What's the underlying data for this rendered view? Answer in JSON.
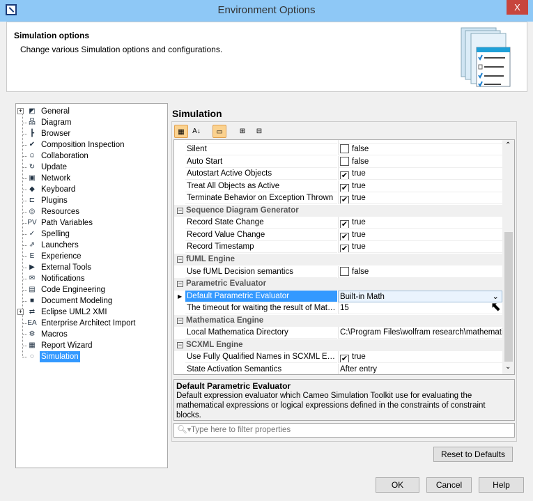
{
  "window": {
    "title": "Environment Options",
    "close": "X"
  },
  "header": {
    "title": "Simulation options",
    "subtitle": "Change various Simulation options and configurations."
  },
  "tree": [
    {
      "label": "General",
      "icon": "general-icon",
      "glyph": "◩",
      "expand": true
    },
    {
      "label": "Diagram",
      "icon": "diagram-icon",
      "glyph": "品"
    },
    {
      "label": "Browser",
      "icon": "browser-icon",
      "glyph": "┣"
    },
    {
      "label": "Composition Inspection",
      "icon": "composition-icon",
      "glyph": "✔"
    },
    {
      "label": "Collaboration",
      "icon": "collaboration-icon",
      "glyph": "☺"
    },
    {
      "label": "Update",
      "icon": "update-icon",
      "glyph": "↻"
    },
    {
      "label": "Network",
      "icon": "network-icon",
      "glyph": "▣"
    },
    {
      "label": "Keyboard",
      "icon": "keyboard-icon",
      "glyph": "◆"
    },
    {
      "label": "Plugins",
      "icon": "plugins-icon",
      "glyph": "⊏"
    },
    {
      "label": "Resources",
      "icon": "resources-icon",
      "glyph": "◎"
    },
    {
      "label": "Path Variables",
      "icon": "path-variables-icon",
      "glyph": "PV"
    },
    {
      "label": "Spelling",
      "icon": "spelling-icon",
      "glyph": "✓"
    },
    {
      "label": "Launchers",
      "icon": "launchers-icon",
      "glyph": "⇗"
    },
    {
      "label": "Experience",
      "icon": "experience-icon",
      "glyph": "E"
    },
    {
      "label": "External Tools",
      "icon": "external-tools-icon",
      "glyph": "▶"
    },
    {
      "label": "Notifications",
      "icon": "notifications-icon",
      "glyph": "✉"
    },
    {
      "label": "Code Engineering",
      "icon": "code-engineering-icon",
      "glyph": "▤"
    },
    {
      "label": "Document Modeling",
      "icon": "document-modeling-icon",
      "glyph": "■"
    },
    {
      "label": "Eclipse UML2 XMI",
      "icon": "eclipse-icon",
      "glyph": "⇄",
      "expand": true
    },
    {
      "label": "Enterprise Architect Import",
      "icon": "ea-icon",
      "glyph": "EA"
    },
    {
      "label": "Macros",
      "icon": "macros-icon",
      "glyph": "⚙"
    },
    {
      "label": "Report Wizard",
      "icon": "report-wizard-icon",
      "glyph": "▦"
    },
    {
      "label": "Simulation",
      "icon": "simulation-icon",
      "glyph": "◌",
      "selected": true
    }
  ],
  "panel": {
    "title": "Simulation",
    "toolbar": [
      "categorized-view",
      "sort-alphabetically",
      "show-description",
      "expand-all",
      "collapse-all"
    ]
  },
  "rows": [
    {
      "name": "Silent",
      "value": "false",
      "check": false
    },
    {
      "name": "Auto Start",
      "value": "false",
      "check": false
    },
    {
      "name": "Autostart Active Objects",
      "value": "true",
      "check": true
    },
    {
      "name": "Treat All Objects as Active",
      "value": "true",
      "check": true
    },
    {
      "name": "Terminate Behavior on Exception Thrown",
      "value": "true",
      "check": true
    },
    {
      "header": "Sequence Diagram Generator"
    },
    {
      "name": "Record State Change",
      "value": "true",
      "check": true
    },
    {
      "name": "Record Value Change",
      "value": "true",
      "check": true
    },
    {
      "name": "Record Timestamp",
      "value": "true",
      "check": true
    },
    {
      "header": "fUML Engine"
    },
    {
      "name": "Use fUML Decision semantics",
      "value": "false",
      "check": false
    },
    {
      "header": "Parametric Evaluator"
    },
    {
      "name": "Default Parametric Evaluator",
      "value": "Built-in Math",
      "selected": true
    },
    {
      "name": "The timeout for waiting the result of Math...",
      "value": "15"
    },
    {
      "header": "Mathematica Engine"
    },
    {
      "name": "Local Mathematica Directory",
      "value": "C:\\Program Files\\wolfram research\\mathematica\\"
    },
    {
      "header": "SCXML Engine"
    },
    {
      "name": "Use Fully Qualified Names in SCXML Export",
      "value": "true",
      "check": true
    },
    {
      "name": "State Activation Semantics",
      "value": "After entry"
    }
  ],
  "description": {
    "title": "Default Parametric Evaluator",
    "text": "Default expression evaluator which Cameo Simulation Toolkit use for evaluating the mathematical expressions or logical expressions defined in the constraints of constraint blocks."
  },
  "filter": {
    "placeholder": "Type here to filter properties"
  },
  "buttons": {
    "reset": "Reset to Defaults",
    "ok": "OK",
    "cancel": "Cancel",
    "help": "Help"
  }
}
